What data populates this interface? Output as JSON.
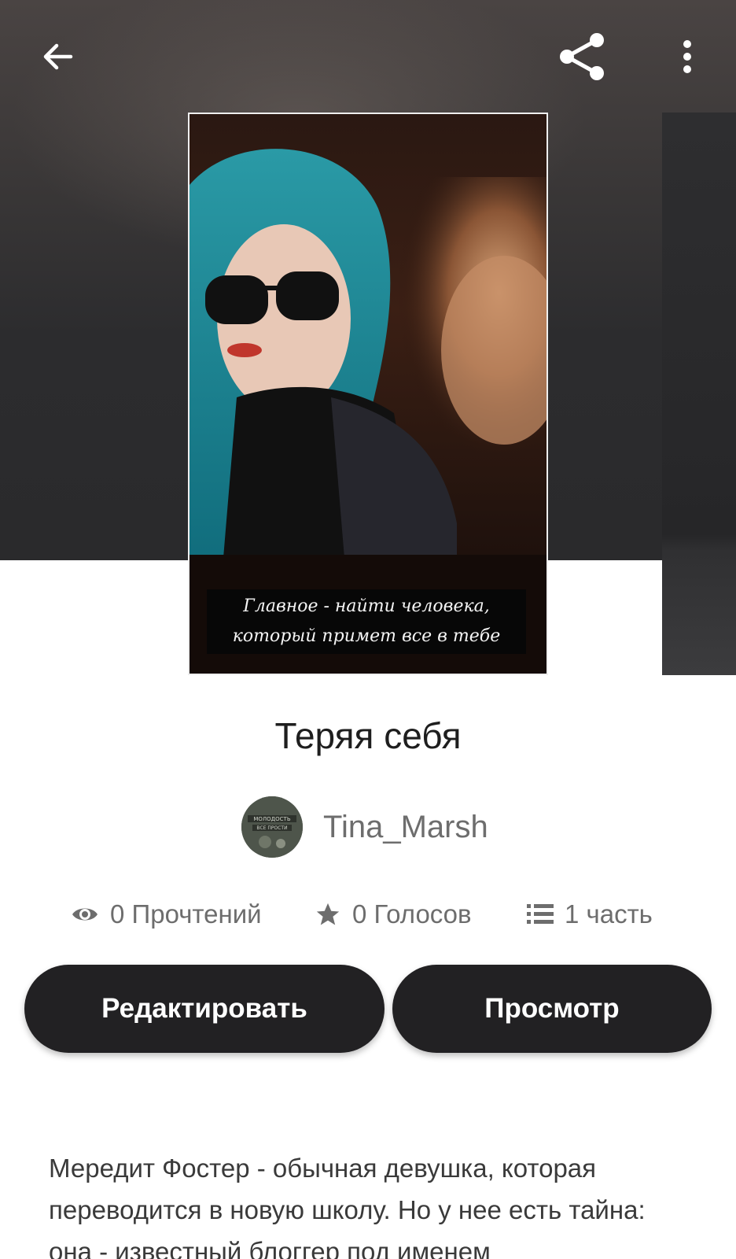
{
  "header": {
    "back_icon": "arrow-left-icon",
    "share_icon": "share-icon",
    "more_icon": "more-vertical-icon"
  },
  "cover": {
    "caption_line1": "Главное - найти человека,",
    "caption_line2": "который примет все в тебе"
  },
  "story": {
    "title": "Теряя себя",
    "author": "Tina_Marsh",
    "avatar_text_line1": "МОЛОДОСТЬ",
    "avatar_text_line2": "ВСЕ ПРОСТИ"
  },
  "stats": {
    "reads": "0 Прочтений",
    "votes": "0 Голосов",
    "parts": "1 часть"
  },
  "actions": {
    "edit_label": "Редактировать",
    "view_label": "Просмотр"
  },
  "description": "Мередит Фостер - обычная девушка, которая переводится в новую школу. Но у нее есть тайна: она - известный блоггер под именем",
  "colors": {
    "button_bg": "#222123",
    "button_text": "#ffffff",
    "muted_text": "#6d6d6d",
    "title_text": "#1e1e1e"
  }
}
